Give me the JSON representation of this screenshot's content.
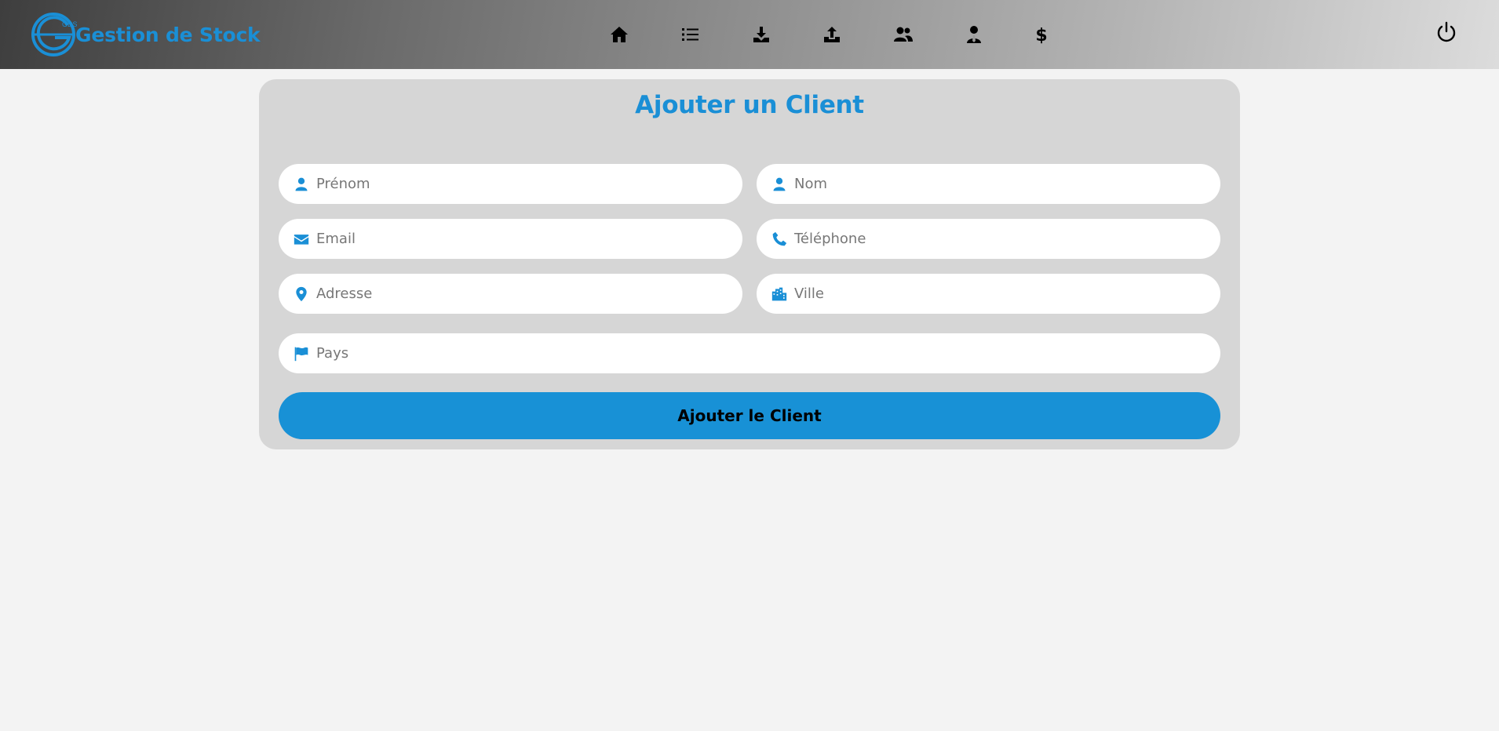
{
  "brand": {
    "name": "Gestion de Stock",
    "logo_text": "GDS",
    "color": "#1a8fd6"
  },
  "nav": {
    "items": [
      {
        "icon": "home-icon"
      },
      {
        "icon": "list-icon"
      },
      {
        "icon": "download-icon"
      },
      {
        "icon": "upload-icon"
      },
      {
        "icon": "users-icon"
      },
      {
        "icon": "user-tie-icon"
      },
      {
        "icon": "dollar-icon"
      }
    ],
    "logout_icon": "power-icon"
  },
  "form": {
    "title": "Ajouter un Client",
    "fields": {
      "prenom": {
        "placeholder": "Prénom",
        "icon": "user-icon"
      },
      "nom": {
        "placeholder": "Nom",
        "icon": "user-icon"
      },
      "email": {
        "placeholder": "Email",
        "icon": "envelope-icon"
      },
      "telephone": {
        "placeholder": "Téléphone",
        "icon": "phone-icon"
      },
      "adresse": {
        "placeholder": "Adresse",
        "icon": "map-pin-icon"
      },
      "ville": {
        "placeholder": "Ville",
        "icon": "city-icon"
      },
      "pays": {
        "placeholder": "Pays",
        "icon": "flag-icon"
      }
    },
    "submit_label": "Ajouter le Client"
  },
  "colors": {
    "accent": "#1a8fd6",
    "card": "#d6d6d6",
    "page": "#f3f3f3"
  }
}
